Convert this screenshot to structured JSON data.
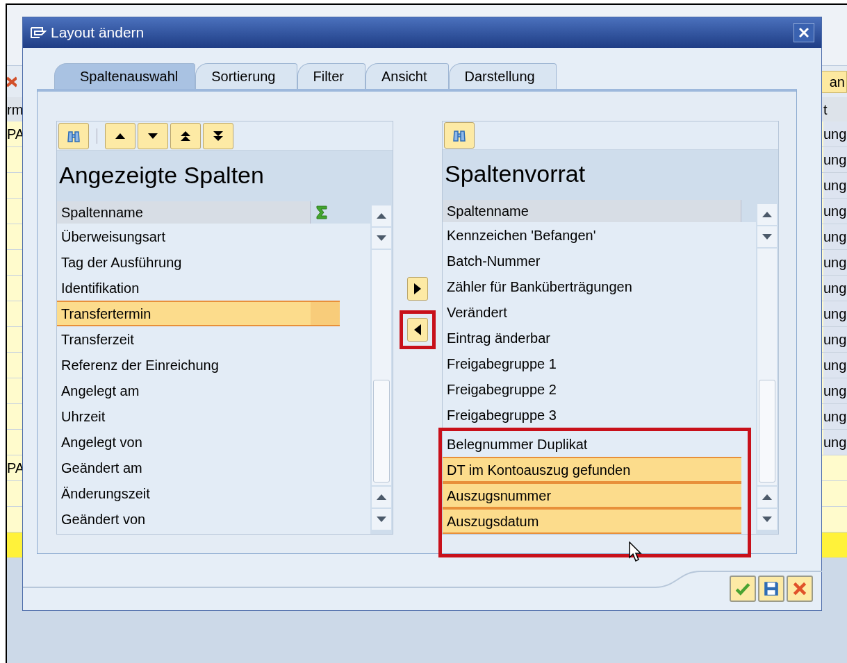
{
  "background": {
    "toolbar_button": "an",
    "header": {
      "left": "rm",
      "right": "t"
    },
    "rows": [
      {
        "kind": "data",
        "left": "PA",
        "right": "ung"
      },
      {
        "kind": "data",
        "right": "ung"
      },
      {
        "kind": "data",
        "right": "ung"
      },
      {
        "kind": "data",
        "right": "ung"
      },
      {
        "kind": "data",
        "right": "ung"
      },
      {
        "kind": "data",
        "right": "ung"
      },
      {
        "kind": "data",
        "right": "ung"
      },
      {
        "kind": "data",
        "right": "ung"
      },
      {
        "kind": "data",
        "right": "ung"
      },
      {
        "kind": "data",
        "right": "ung"
      },
      {
        "kind": "data",
        "right": "ung"
      },
      {
        "kind": "data",
        "right": "ung"
      },
      {
        "kind": "data",
        "right": "ung"
      },
      {
        "kind": "data",
        "left": "PA"
      },
      {
        "kind": "data"
      },
      {
        "kind": "data"
      },
      {
        "kind": "marked"
      }
    ]
  },
  "dialog": {
    "title": "Layout ändern",
    "tabs": [
      {
        "label": "Spaltenauswahl",
        "selected": true
      },
      {
        "label": "Sortierung",
        "selected": false
      },
      {
        "label": "Filter",
        "selected": false
      },
      {
        "label": "Ansicht",
        "selected": false
      },
      {
        "label": "Darstellung",
        "selected": false
      }
    ],
    "displayed_columns": {
      "title": "Angezeigte Spalten",
      "column_header": "Spaltenname",
      "items": [
        {
          "label": "Überweisungsart",
          "selected": false
        },
        {
          "label": "Tag der Ausführung",
          "selected": false
        },
        {
          "label": "Identifikation",
          "selected": false
        },
        {
          "label": "Transfertermin",
          "selected": true
        },
        {
          "label": "Transferzeit",
          "selected": false
        },
        {
          "label": "Referenz der Einreichung",
          "selected": false
        },
        {
          "label": "Angelegt am",
          "selected": false
        },
        {
          "label": "Uhrzeit",
          "selected": false
        },
        {
          "label": "Angelegt von",
          "selected": false
        },
        {
          "label": "Geändert am",
          "selected": false
        },
        {
          "label": "Änderungszeit",
          "selected": false
        },
        {
          "label": "Geändert von",
          "selected": false
        }
      ]
    },
    "transfer_buttons": [
      {
        "kind": "move-right",
        "highlighted": false
      },
      {
        "kind": "move-left",
        "highlighted": true
      }
    ],
    "column_set": {
      "title": "Spaltenvorrat",
      "column_header": "Spaltenname",
      "items": [
        {
          "label": "Kennzeichen 'Befangen'",
          "selected": false
        },
        {
          "label": "Batch-Nummer",
          "selected": false
        },
        {
          "label": "Zähler für Banküberträgungen",
          "selected": false
        },
        {
          "label": "Verändert",
          "selected": false
        },
        {
          "label": "Eintrag änderbar",
          "selected": false
        },
        {
          "label": "Freigabegruppe 1",
          "selected": false
        },
        {
          "label": "Freigabegruppe 2",
          "selected": false
        },
        {
          "label": "Freigabegruppe 3",
          "selected": false
        }
      ],
      "highlighted_items": [
        {
          "label": "Belegnummer Duplikat",
          "selected": false
        },
        {
          "label": "DT im Kontoauszug gefunden",
          "selected": true
        },
        {
          "label": "Auszugsnummer",
          "selected": true
        },
        {
          "label": "Auszugsdatum",
          "selected": true
        }
      ]
    },
    "footer_buttons": [
      {
        "kind": "confirm"
      },
      {
        "kind": "save"
      },
      {
        "kind": "cancel"
      }
    ]
  }
}
